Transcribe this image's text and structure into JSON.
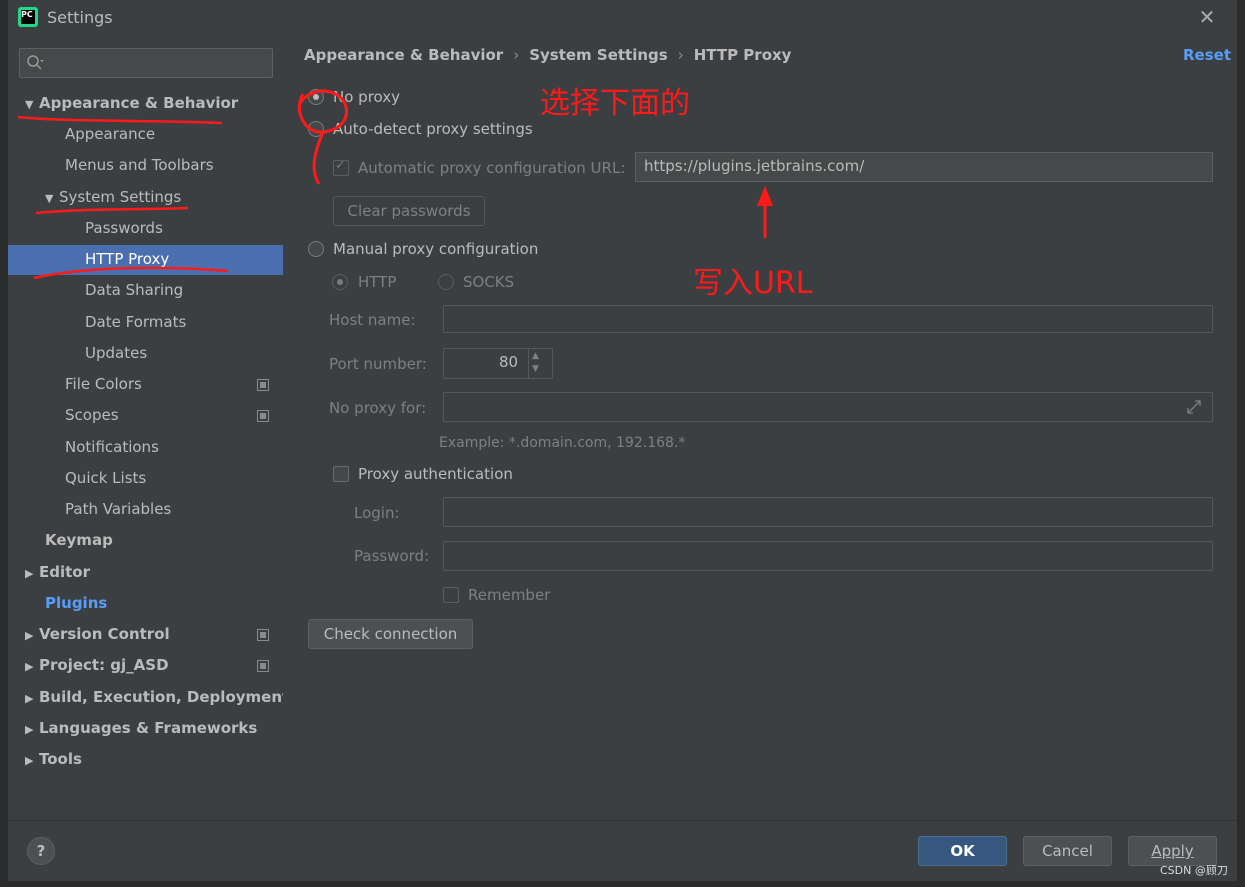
{
  "window": {
    "title": "Settings",
    "app_icon_text": "PC"
  },
  "search": {
    "placeholder": ""
  },
  "sidebar": {
    "items": [
      {
        "label": "Appearance & Behavior",
        "expanded": true
      },
      {
        "label": "Appearance"
      },
      {
        "label": "Menus and Toolbars"
      },
      {
        "label": "System Settings",
        "expanded": true
      },
      {
        "label": "Passwords"
      },
      {
        "label": "HTTP Proxy",
        "selected": true
      },
      {
        "label": "Data Sharing"
      },
      {
        "label": "Date Formats"
      },
      {
        "label": "Updates"
      },
      {
        "label": "File Colors"
      },
      {
        "label": "Scopes"
      },
      {
        "label": "Notifications"
      },
      {
        "label": "Quick Lists"
      },
      {
        "label": "Path Variables"
      },
      {
        "label": "Keymap"
      },
      {
        "label": "Editor"
      },
      {
        "label": "Plugins"
      },
      {
        "label": "Version Control"
      },
      {
        "label": "Project: gj_ASD"
      },
      {
        "label": "Build, Execution, Deployment"
      },
      {
        "label": "Languages & Frameworks"
      },
      {
        "label": "Tools"
      }
    ]
  },
  "breadcrumb": [
    "Appearance & Behavior",
    "System Settings",
    "HTTP Proxy"
  ],
  "reset_label": "Reset",
  "proxy": {
    "no_proxy_label": "No proxy",
    "auto_detect_label": "Auto-detect proxy settings",
    "auto_config_url_label": "Automatic proxy configuration URL:",
    "auto_config_url_value": "https://plugins.jetbrains.com/",
    "clear_passwords_label": "Clear passwords",
    "manual_label": "Manual proxy configuration",
    "http_label": "HTTP",
    "socks_label": "SOCKS",
    "host_name_label": "Host name:",
    "host_name_value": "",
    "port_number_label": "Port number:",
    "port_number_value": "80",
    "no_proxy_for_label": "No proxy for:",
    "no_proxy_for_value": "",
    "example_text": "Example: *.domain.com, 192.168.*",
    "proxy_auth_label": "Proxy authentication",
    "login_label": "Login:",
    "login_value": "",
    "password_label": "Password:",
    "password_value": "",
    "remember_label": "Remember",
    "check_connection_label": "Check connection"
  },
  "footer": {
    "help_label": "?",
    "ok_label": "OK",
    "cancel_label": "Cancel",
    "apply_label": "Apply"
  },
  "annotations": {
    "select_below": "选择下面的",
    "enter_url": "写入URL"
  },
  "watermark": "CSDN @顾刀",
  "colors": {
    "background": "#3c3f41",
    "selection": "#4b6eaf",
    "link": "#589df6",
    "annotation": "#ff1a1a",
    "primary_button": "#365880"
  }
}
